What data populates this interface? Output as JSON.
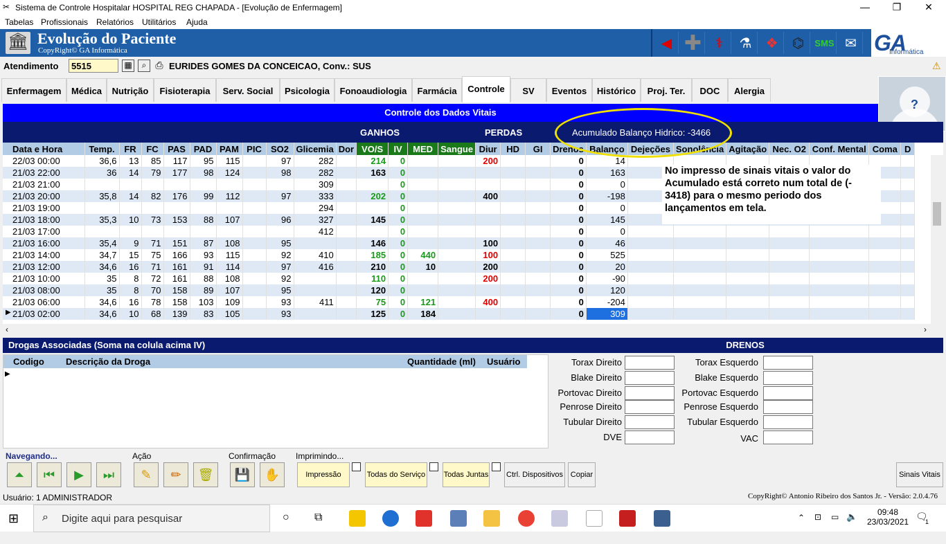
{
  "window": {
    "title": "Sistema de Controle Hospitalar HOSPITAL REG CHAPADA - [Evolução de Enfermagem]"
  },
  "menu": [
    "Tabelas",
    "Profissionais",
    "Relatórios",
    "Utilitários",
    "Ajuda"
  ],
  "header": {
    "title": "Evolução do Paciente",
    "copyright": "CopyRight© GA Informática"
  },
  "logo": {
    "text": "GA",
    "sub": "Informática"
  },
  "atendimento": {
    "label": "Atendimento",
    "value": "5515",
    "patient": "EURIDES GOMES DA CONCEICAO, Conv.: SUS"
  },
  "tabs": [
    "Enfermagem",
    "Médica",
    "Nutrição",
    "Fisioterapia",
    "Serv. Social",
    "Psicologia",
    "Fonoaudiologia",
    "Farmácia",
    "Controle",
    "SV",
    "Eventos",
    "Histórico",
    "Proj. Ter.",
    "DOC",
    "Alergia"
  ],
  "avatar_text": "?",
  "vitals": {
    "title": "Controle dos Dados Vitais",
    "ganhos": "GANHOS",
    "perdas": "PERDAS",
    "acumulado": "Acumulado Balanço Hidrico: -3466",
    "columns": [
      "Data e Hora",
      "Temp.",
      "FR",
      "FC",
      "PAS",
      "PAD",
      "PAM",
      "PIC",
      "SO2",
      "Glicemia",
      "Dor",
      "VO/S",
      "IV",
      "MED",
      "Sangue",
      "Diur",
      "HD",
      "GI",
      "Drenos",
      "Balanço",
      "Dejeções",
      "Sonolência",
      "Agitação",
      "Nec. O2",
      "Conf. Mental",
      "Coma",
      "D"
    ],
    "rows": [
      [
        "22/03 00:00",
        "36,6",
        "13",
        "85",
        "117",
        "95",
        "115",
        "",
        "97",
        "282",
        "",
        "214",
        "0",
        "",
        "",
        "200",
        "",
        "",
        "0",
        "14"
      ],
      [
        "21/03 22:00",
        "36",
        "14",
        "79",
        "177",
        "98",
        "124",
        "",
        "98",
        "282",
        "",
        "163",
        "0",
        "",
        "",
        "",
        "",
        "",
        "0",
        "163"
      ],
      [
        "21/03 21:00",
        "",
        "",
        "",
        "",
        "",
        "",
        "",
        "",
        "309",
        "",
        "",
        "0",
        "",
        "",
        "",
        "",
        "",
        "0",
        "0"
      ],
      [
        "21/03 20:00",
        "35,8",
        "14",
        "82",
        "176",
        "99",
        "112",
        "",
        "97",
        "333",
        "",
        "202",
        "0",
        "",
        "",
        "400",
        "",
        "",
        "0",
        "-198"
      ],
      [
        "21/03 19:00",
        "",
        "",
        "",
        "",
        "",
        "",
        "",
        "",
        "294",
        "",
        "",
        "0",
        "",
        "",
        "",
        "",
        "",
        "0",
        "0"
      ],
      [
        "21/03 18:00",
        "35,3",
        "10",
        "73",
        "153",
        "88",
        "107",
        "",
        "96",
        "327",
        "",
        "145",
        "0",
        "",
        "",
        "",
        "",
        "",
        "0",
        "145"
      ],
      [
        "21/03 17:00",
        "",
        "",
        "",
        "",
        "",
        "",
        "",
        "",
        "412",
        "",
        "",
        "0",
        "",
        "",
        "",
        "",
        "",
        "0",
        "0"
      ],
      [
        "21/03 16:00",
        "35,4",
        "9",
        "71",
        "151",
        "87",
        "108",
        "",
        "95",
        "",
        "",
        "146",
        "0",
        "",
        "",
        "100",
        "",
        "",
        "0",
        "46"
      ],
      [
        "21/03 14:00",
        "34,7",
        "15",
        "75",
        "166",
        "93",
        "115",
        "",
        "92",
        "410",
        "",
        "185",
        "0",
        "440",
        "",
        "100",
        "",
        "",
        "0",
        "525"
      ],
      [
        "21/03 12:00",
        "34,6",
        "16",
        "71",
        "161",
        "91",
        "114",
        "",
        "97",
        "416",
        "",
        "210",
        "0",
        "10",
        "",
        "200",
        "",
        "",
        "0",
        "20"
      ],
      [
        "21/03 10:00",
        "35",
        "8",
        "72",
        "161",
        "88",
        "108",
        "",
        "92",
        "",
        "",
        "110",
        "0",
        "",
        "",
        "200",
        "",
        "",
        "0",
        "-90"
      ],
      [
        "21/03 08:00",
        "35",
        "8",
        "70",
        "158",
        "89",
        "107",
        "",
        "95",
        "",
        "",
        "120",
        "0",
        "",
        "",
        "",
        "",
        "",
        "0",
        "120"
      ],
      [
        "21/03 06:00",
        "34,6",
        "16",
        "78",
        "158",
        "103",
        "109",
        "",
        "93",
        "411",
        "",
        "75",
        "0",
        "121",
        "",
        "400",
        "",
        "",
        "0",
        "-204"
      ],
      [
        "21/03 02:00",
        "34,6",
        "10",
        "68",
        "139",
        "83",
        "105",
        "",
        "93",
        "",
        "",
        "125",
        "0",
        "184",
        "",
        "",
        "",
        "",
        "0",
        "309"
      ]
    ],
    "row_styles": {
      "vos_green": [
        0,
        3,
        8,
        10,
        12
      ],
      "diur_red": [
        0,
        8,
        10,
        12
      ],
      "med_green": [
        8,
        12
      ]
    }
  },
  "note": "No impresso de sinais vitais o valor do Acumulado está correto num total de (- 3418) para o mesmo periodo dos lançamentos em tela.",
  "drogas": {
    "title": "Drogas Associadas (Soma na colula acima IV)",
    "columns": [
      "Codigo",
      "Descrição da Droga",
      "Quantidade (ml)",
      "Usuário"
    ]
  },
  "drenos": {
    "title": "DRENOS",
    "left": [
      "Torax Direito",
      "Blake Direito",
      "Portovac Direito",
      "Penrose Direito",
      "Tubular Direito",
      "DVE"
    ],
    "right": [
      "Torax Esquerdo",
      "Blake Esquerdo",
      "Portovac Esquerdo",
      "Penrose Esquerdo",
      "Tubular Esquerdo",
      "VAC"
    ]
  },
  "bottom": {
    "navegando": "Navegando...",
    "acao": "Ação",
    "confirmacao": "Confirmação",
    "imprimindo": "Imprimindo...",
    "impressao": "Impressão",
    "todas_servico": "Todas do Serviço",
    "todas_juntas": "Todas Juntas",
    "ctrl": "Ctrl. Dispositivos",
    "copiar": "Copiar",
    "sinais": "Sinais Vitais"
  },
  "status": {
    "user": "Usuário: 1  ADMINISTRADOR",
    "copyright": "CopyRight© Antonio Ribeiro dos Santos Jr. - Versão: 2.0.4.76"
  },
  "taskbar": {
    "search": "Digite aqui para pesquisar",
    "time": "09:48",
    "date": "23/03/2021",
    "notif": "1"
  }
}
